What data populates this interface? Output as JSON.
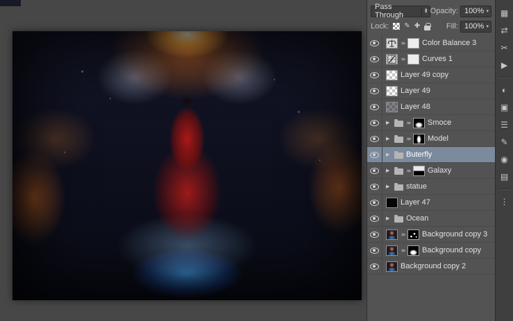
{
  "canvas": {
    "alt": "Fantasy digital painting: winged woman in red gown over glowing blue water pool, orange fire and butterflies on a dark rocky background"
  },
  "layers_panel": {
    "blend_mode": "Pass Through",
    "opacity_label": "Opacity:",
    "opacity_value": "100%",
    "lock_label": "Lock:",
    "fill_label": "Fill:",
    "fill_value": "100%",
    "selected_layer": "Buterfly",
    "colors": {
      "panel_background": "#535353",
      "selected_row": "#7b8a9d"
    },
    "layers": [
      {
        "name": "Color Balance 3",
        "kind": "adjustment",
        "adj_icon": "balance",
        "mask": "white"
      },
      {
        "name": "Curves 1",
        "kind": "adjustment",
        "adj_icon": "curves",
        "mask": "white"
      },
      {
        "name": "Layer 49 copy",
        "kind": "layer",
        "thumb": "checker"
      },
      {
        "name": "Layer 49",
        "kind": "layer",
        "thumb": "checker"
      },
      {
        "name": "Layer 48",
        "kind": "layer",
        "thumb": "checker-dark"
      },
      {
        "name": "Smoce",
        "kind": "group",
        "mask": "blob"
      },
      {
        "name": "Model",
        "kind": "group",
        "mask": "figure"
      },
      {
        "name": "Buterfly",
        "kind": "group",
        "selected": true
      },
      {
        "name": "Galaxy",
        "kind": "group",
        "mask": "top"
      },
      {
        "name": "statue",
        "kind": "group"
      },
      {
        "name": "Layer 47",
        "kind": "layer",
        "thumb": "black"
      },
      {
        "name": "Ocean",
        "kind": "group"
      },
      {
        "name": "Background copy 3",
        "kind": "layer",
        "thumb": "art",
        "mask": "speckle"
      },
      {
        "name": "Background copy",
        "kind": "layer",
        "thumb": "art",
        "mask": "blob"
      },
      {
        "name": "Background copy 2",
        "kind": "layer",
        "thumb": "art"
      }
    ]
  },
  "dock": {
    "icons": [
      {
        "name": "dock-grid-icon",
        "glyph": "▦"
      },
      {
        "name": "dock-transform-arrows-icon",
        "glyph": "⇄"
      },
      {
        "name": "dock-scissors-icon",
        "glyph": "✂"
      },
      {
        "name": "dock-play-icon",
        "glyph": "▶"
      },
      {
        "name": "divider",
        "glyph": ""
      },
      {
        "name": "dock-contrast-icon",
        "glyph": "◐"
      },
      {
        "name": "dock-swatches-icon",
        "glyph": "▣"
      },
      {
        "name": "dock-adjustments-icon",
        "glyph": "☰"
      },
      {
        "name": "dock-pen-icon",
        "glyph": "✎"
      },
      {
        "name": "dock-target-icon",
        "glyph": "◉"
      },
      {
        "name": "dock-layers-icon",
        "glyph": "▤"
      },
      {
        "name": "divider",
        "glyph": ""
      },
      {
        "name": "dock-more-icon",
        "glyph": "⋮"
      }
    ]
  }
}
